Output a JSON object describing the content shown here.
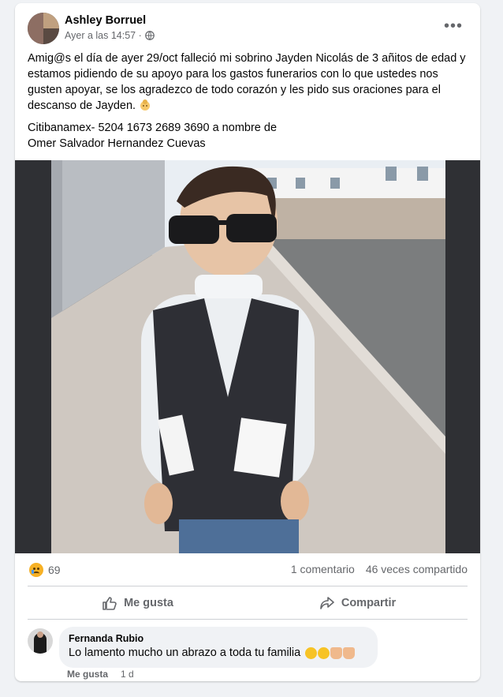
{
  "post": {
    "author": "Ashley Borruel",
    "time": "Ayer a las 14:57 · ",
    "more_label": "•••",
    "paragraph1": "Amig@s el día de ayer 29/oct falleció mi sobrino Jayden Nicolás de 3 añitos de edad y estamos pidiendo de su apoyo para los gastos funerarios con lo que ustedes nos gusten apoyar, se los agradezco de todo corazón y les pido sus oraciones para el descanso de Jayden.",
    "bank_line1": "Citibanamex- 5204 1673 2689 3690 a nombre de",
    "bank_line2": "Omer Salvador Hernandez Cuevas"
  },
  "stats": {
    "reactions_count": "69",
    "comments": "1 comentario",
    "shares": "46 veces compartido"
  },
  "actions": {
    "like": "Me gusta",
    "share": "Compartir"
  },
  "comment": {
    "author": "Fernanda Rubio",
    "text": "Lo lamento mucho un abrazo a toda tu familia",
    "like": "Me gusta",
    "age": "1 d"
  },
  "icons": {
    "privacy": "globe-icon",
    "reaction": "sad-reaction-icon",
    "like": "thumbs-up-icon",
    "share": "share-arrow-icon"
  }
}
